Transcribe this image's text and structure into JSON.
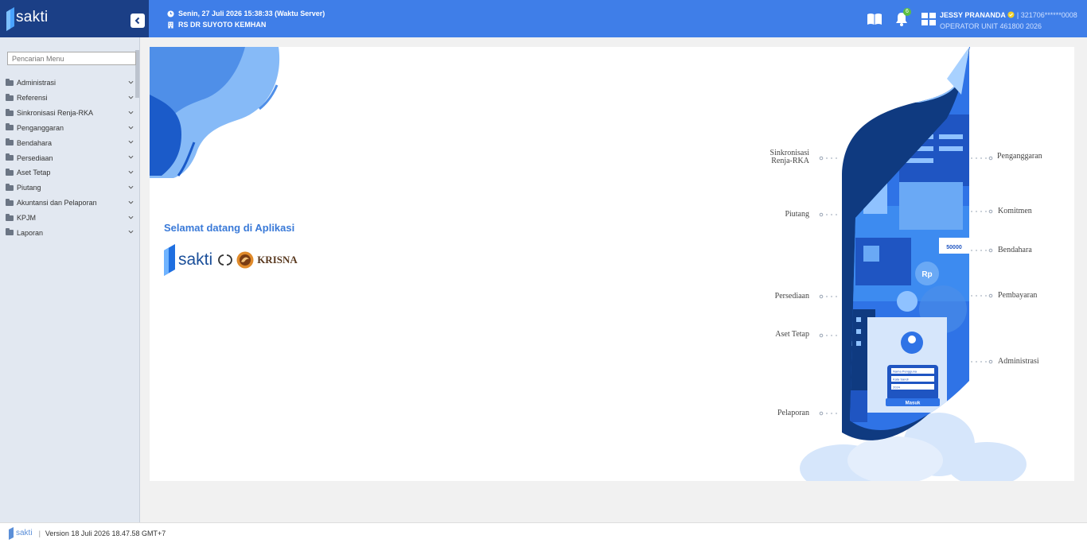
{
  "brand": {
    "name": "sakti"
  },
  "header": {
    "datetime": "Senin, 27 Juli 2026 15:38:33 (Waktu Server)",
    "unit": "RS DR SUYOTO KEMHAN",
    "notification_count": "6",
    "user_name": "JESSY PRANANDA",
    "user_nip": "| 321706******0008",
    "user_role": "OPERATOR UNIT 461800 2026"
  },
  "sidebar": {
    "search_placeholder": "Pencarian Menu",
    "items": [
      {
        "label": "Administrasi"
      },
      {
        "label": "Referensi"
      },
      {
        "label": "Sinkronisasi Renja-RKA"
      },
      {
        "label": "Penganggaran"
      },
      {
        "label": "Bendahara"
      },
      {
        "label": "Persediaan"
      },
      {
        "label": "Aset Tetap"
      },
      {
        "label": "Piutang"
      },
      {
        "label": "Akuntansi dan Pelaporan"
      },
      {
        "label": "KPJM"
      },
      {
        "label": "Laporan"
      }
    ]
  },
  "main": {
    "welcome": "Selamat datang di Aplikasi",
    "brand_sakti": "sakti",
    "brand_krisna": "KRISNA",
    "illustration": {
      "left_labels": [
        "Sinkronisasi",
        "Renja-RKA",
        "Piutang",
        "Persediaan",
        "Aset Tetap",
        "Pelaporan"
      ],
      "right_labels": [
        "Penganggaran",
        "Komitmen",
        "Bendahara",
        "Pembayaran",
        "Administrasi"
      ],
      "money_note": "50000",
      "currency": "Rp",
      "login_button": "Masuk",
      "login_field_user": "Nama Pengguna",
      "login_field_password": "Kata Sandi",
      "login_field_year": "2024"
    }
  },
  "footer": {
    "logo": "sakti",
    "version": "Version 18 Juli 2026 18.47.58 GMT+7"
  },
  "colors": {
    "topbar": "#3f7ee8",
    "brand_bg": "#1b3f86",
    "sidebar_bg": "#e2e8f1",
    "accent": "#3a7ad8"
  }
}
